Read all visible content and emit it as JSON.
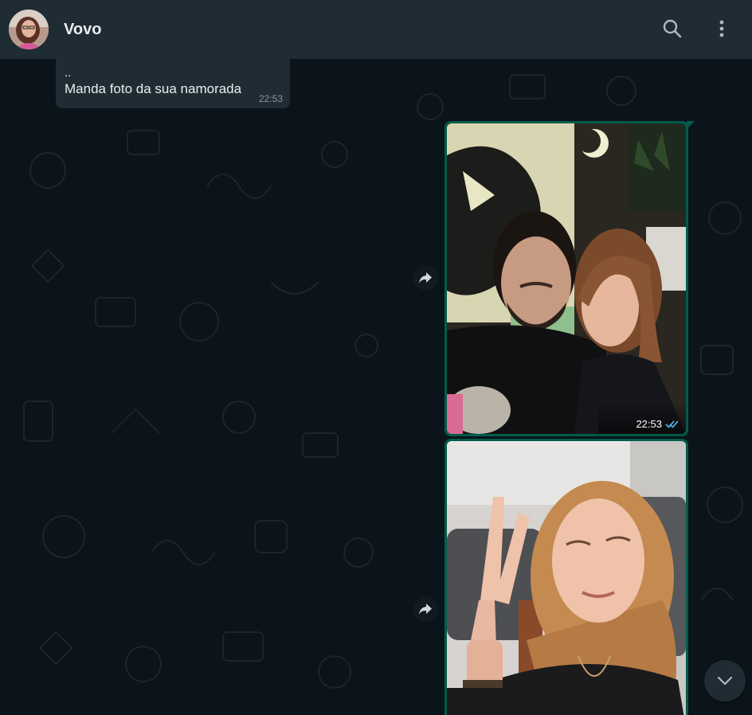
{
  "header": {
    "contact_name": "Vovo",
    "avatar_icon": "user-avatar",
    "search_icon": "search-icon",
    "menu_icon": "more-vertical-icon"
  },
  "messages": [
    {
      "direction": "incoming",
      "lines": [
        "..",
        "Manda foto da sua namorada"
      ],
      "time": "22:53"
    },
    {
      "direction": "outgoing",
      "type": "image",
      "time": "22:53",
      "status": "read"
    },
    {
      "direction": "outgoing",
      "type": "image",
      "status": "read"
    }
  ],
  "colors": {
    "header_bg": "#202c33",
    "chat_bg": "#0b141a",
    "incoming_bubble": "#202c33",
    "outgoing_bubble": "#005c4b",
    "read_ticks": "#53bdeb"
  }
}
